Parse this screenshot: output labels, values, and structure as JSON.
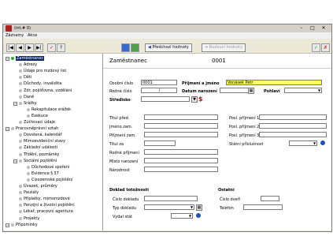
{
  "window": {
    "title": "(int.# 0)"
  },
  "menu": {
    "items": [
      "Záznamy",
      "Akce"
    ]
  },
  "toolbar": {
    "prev_label": "Předchozí hodnoty",
    "next_label": "Budoucí hodnoty"
  },
  "tree": {
    "items": [
      {
        "label": "Zaměstnanec",
        "level": 0
      },
      {
        "label": "Adresy",
        "level": 2
      },
      {
        "label": "Údaje pro mzdový list",
        "level": 2
      },
      {
        "label": "Děti",
        "level": 2
      },
      {
        "label": "Důchody, invalidita",
        "level": 2
      },
      {
        "label": "Zdr. pojišťovna, vzdělání",
        "level": 2
      },
      {
        "label": "Daně",
        "level": 2
      },
      {
        "label": "Srážky",
        "level": 1
      },
      {
        "label": "Rekapitulace srážek",
        "level": 3
      },
      {
        "label": "Exekuce",
        "level": 3
      },
      {
        "label": "Zúčtovací údaje",
        "level": 2
      },
      {
        "label": "Pracovněprávní vztah",
        "level": 0
      },
      {
        "label": "Dovolená, kalendář",
        "level": 2
      },
      {
        "label": "Mimoevidenční stavy",
        "level": 2
      },
      {
        "label": "Základní události",
        "level": 2
      },
      {
        "label": "Třídění, poznámky",
        "level": 2
      },
      {
        "label": "Sociální pojištění",
        "level": 1
      },
      {
        "label": "Důchodové spoření",
        "level": 3
      },
      {
        "label": "Evidence § 37",
        "level": 3
      },
      {
        "label": "Cizozemské pojištění",
        "level": 3
      },
      {
        "label": "Úvazek, průměry",
        "level": 2
      },
      {
        "label": "Paušály",
        "level": 2
      },
      {
        "label": "Příplatky, mimomzdové",
        "level": 2
      },
      {
        "label": "Penzijní a životní pojištění",
        "level": 2
      },
      {
        "label": "Lékař, pracovní agentura",
        "level": 2
      },
      {
        "label": "Projekty",
        "level": 2
      },
      {
        "label": "Připomínky",
        "level": 0
      }
    ]
  },
  "form": {
    "header_title": "Zaměstnanec",
    "header_number": "0001",
    "osobni_cislo_label": "Osobní číslo",
    "osobni_cislo_value": "0001",
    "prijmeni_label": "Příjmení a jméno",
    "prijmeni_value": "Vonásek Petr",
    "rodne_cislo_label": "Rodné číslo",
    "rodne_cislo_value": "/",
    "datum_narozeni_label": "Datum narození",
    "pohlavi_label": "Pohlaví",
    "stredisko_label": "Středisko",
    "titul_pred_label": "Titul před",
    "jmeno_zam_label": "Jméno zam.",
    "prijmeni_zam_label": "Příjmení zam.",
    "titul_za_label": "Titul za",
    "rodne_prijmeni_label": "Rodné příjmení",
    "misto_narozeni_label": "Místo narození",
    "narodnost_label": "Národnost",
    "posl_prijmeni_1_label": "Posl. příjmení 1",
    "posl_prijmeni_2_label": "Posl. příjmení 2",
    "posl_prijmeni_3_label": "Posl. příjmení 3",
    "statni_prislusnost_label": "Státní příslušnost",
    "doklad_header": "Doklad totožnosti",
    "cislo_dokladu_label": "Číslo dokladu",
    "typ_dokladu_label": "Typ dokladu",
    "vydal_stat_label": "Vydal stát",
    "ostatni_header": "Ostatní",
    "cislo_dveri_label": "Číslo dveří",
    "telefon_label": "Telefon"
  },
  "colors": {
    "highlight": "#ffff66",
    "selection": "#0a246a"
  }
}
